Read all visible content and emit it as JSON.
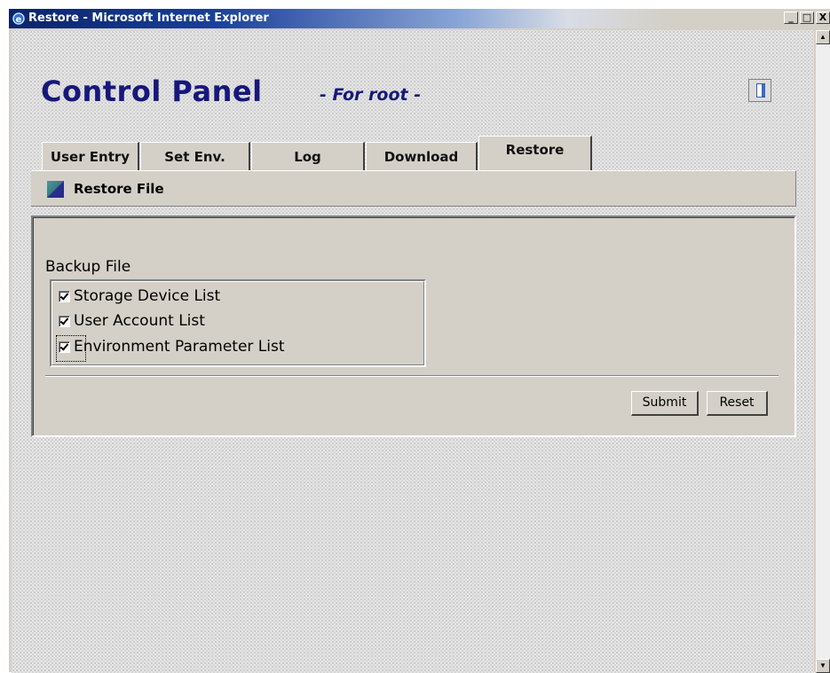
{
  "window": {
    "title": "Restore - Microsoft Internet Explorer",
    "buttons": {
      "minimize": "_",
      "maximize": "□",
      "close": "X"
    }
  },
  "header": {
    "title": "Control Panel",
    "subtitle": "- For root -",
    "exit_icon": "exit-door-icon"
  },
  "tabs": [
    {
      "label": "User Entry",
      "active": false
    },
    {
      "label": "Set Env.",
      "active": false
    },
    {
      "label": "Log",
      "active": false
    },
    {
      "label": "Download",
      "active": false
    },
    {
      "label": "Restore",
      "active": true
    }
  ],
  "section": {
    "icon": "section-icon",
    "title": "Restore File"
  },
  "form": {
    "group_label": "Backup File",
    "options": [
      {
        "label": "Storage Device List",
        "checked": true
      },
      {
        "label": "User Account List",
        "checked": true
      },
      {
        "label": "Environment Parameter List",
        "checked": true,
        "focused": true
      }
    ],
    "submit_label": "Submit",
    "reset_label": "Reset"
  }
}
